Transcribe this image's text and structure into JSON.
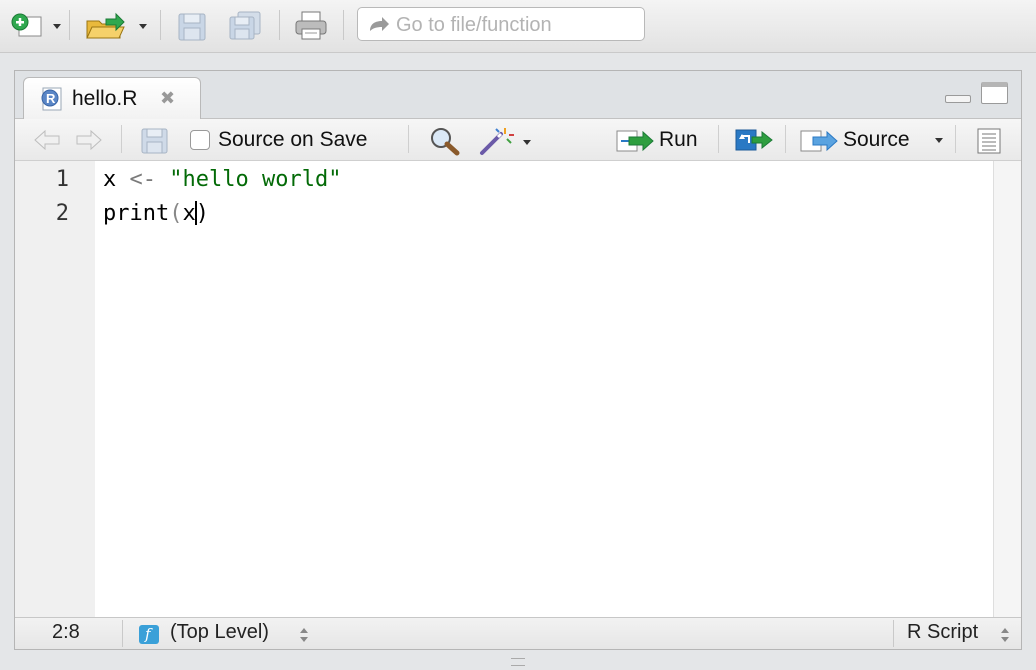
{
  "main_toolbar": {
    "goto_placeholder": "Go to file/function"
  },
  "editor": {
    "tab": {
      "filename": "hello.R",
      "close_glyph": "✖"
    },
    "toolbar": {
      "source_on_save_label": "Source on Save",
      "run_label": "Run",
      "source_label": "Source"
    },
    "line_numbers": [
      "1",
      "2"
    ],
    "code": {
      "line1": {
        "ident": "x",
        "op": "<-",
        "string": "\"hello world\""
      },
      "line2": {
        "func": "print",
        "open": "(",
        "arg": "x",
        "close": ")"
      }
    }
  },
  "status_bar": {
    "cursor_position": "2:8",
    "scope_badge": "f",
    "scope": "(Top Level)",
    "file_type": "R Script"
  },
  "icons": [
    "new-file-icon",
    "open-file-icon",
    "save-icon",
    "save-all-icon",
    "print-icon",
    "goto-arrow-icon",
    "r-file-icon",
    "back-arrow-icon",
    "forward-arrow-icon",
    "find-icon",
    "code-tools-wand-icon",
    "run-icon",
    "rerun-icon",
    "source-icon",
    "outline-icon",
    "minimize-icon",
    "maximize-icon"
  ],
  "colors": {
    "string": "#036a07",
    "keyword_blue": "#2a79c4",
    "run_green": "#2e9e3f"
  }
}
